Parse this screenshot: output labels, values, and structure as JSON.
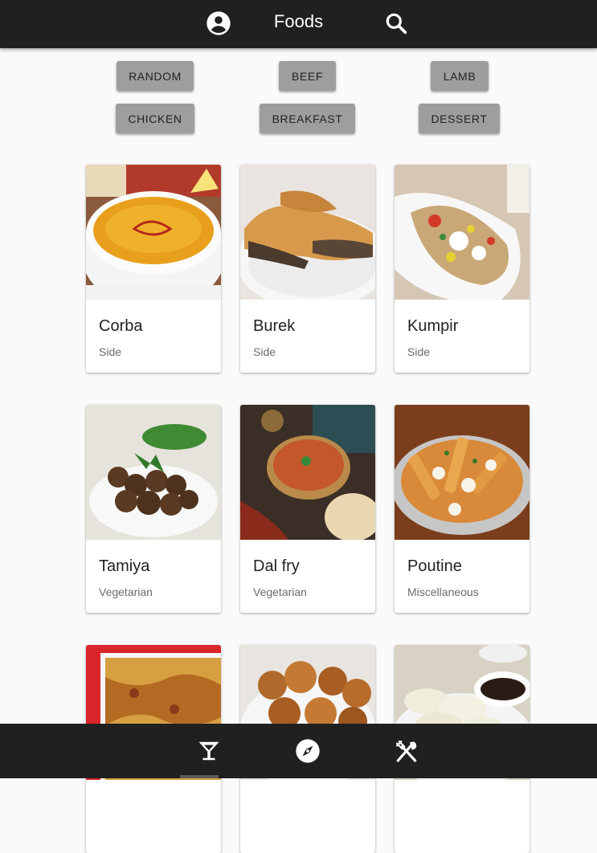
{
  "app": {
    "title": "Foods"
  },
  "header": {
    "account_icon": "account-circle-icon",
    "search_icon": "search-icon"
  },
  "categories": [
    "RANDOM",
    "BEEF",
    "LAMB",
    "CHICKEN",
    "BREAKFAST",
    "DESSERT"
  ],
  "meals": [
    {
      "name": "Corba",
      "category": "Side"
    },
    {
      "name": "Burek",
      "category": "Side"
    },
    {
      "name": "Kumpir",
      "category": "Side"
    },
    {
      "name": "Tamiya",
      "category": "Vegetarian"
    },
    {
      "name": "Dal fry",
      "category": "Vegetarian"
    },
    {
      "name": "Poutine",
      "category": "Miscellaneous"
    },
    {
      "name": "",
      "category": ""
    },
    {
      "name": "",
      "category": ""
    },
    {
      "name": "",
      "category": ""
    }
  ],
  "bottom_nav": {
    "items": [
      "cocktail-icon",
      "compass-icon",
      "utensils-icon"
    ],
    "active": 0
  },
  "colors": {
    "bar": "#202020",
    "chip": "#9e9e9e",
    "background": "#fafafa"
  }
}
